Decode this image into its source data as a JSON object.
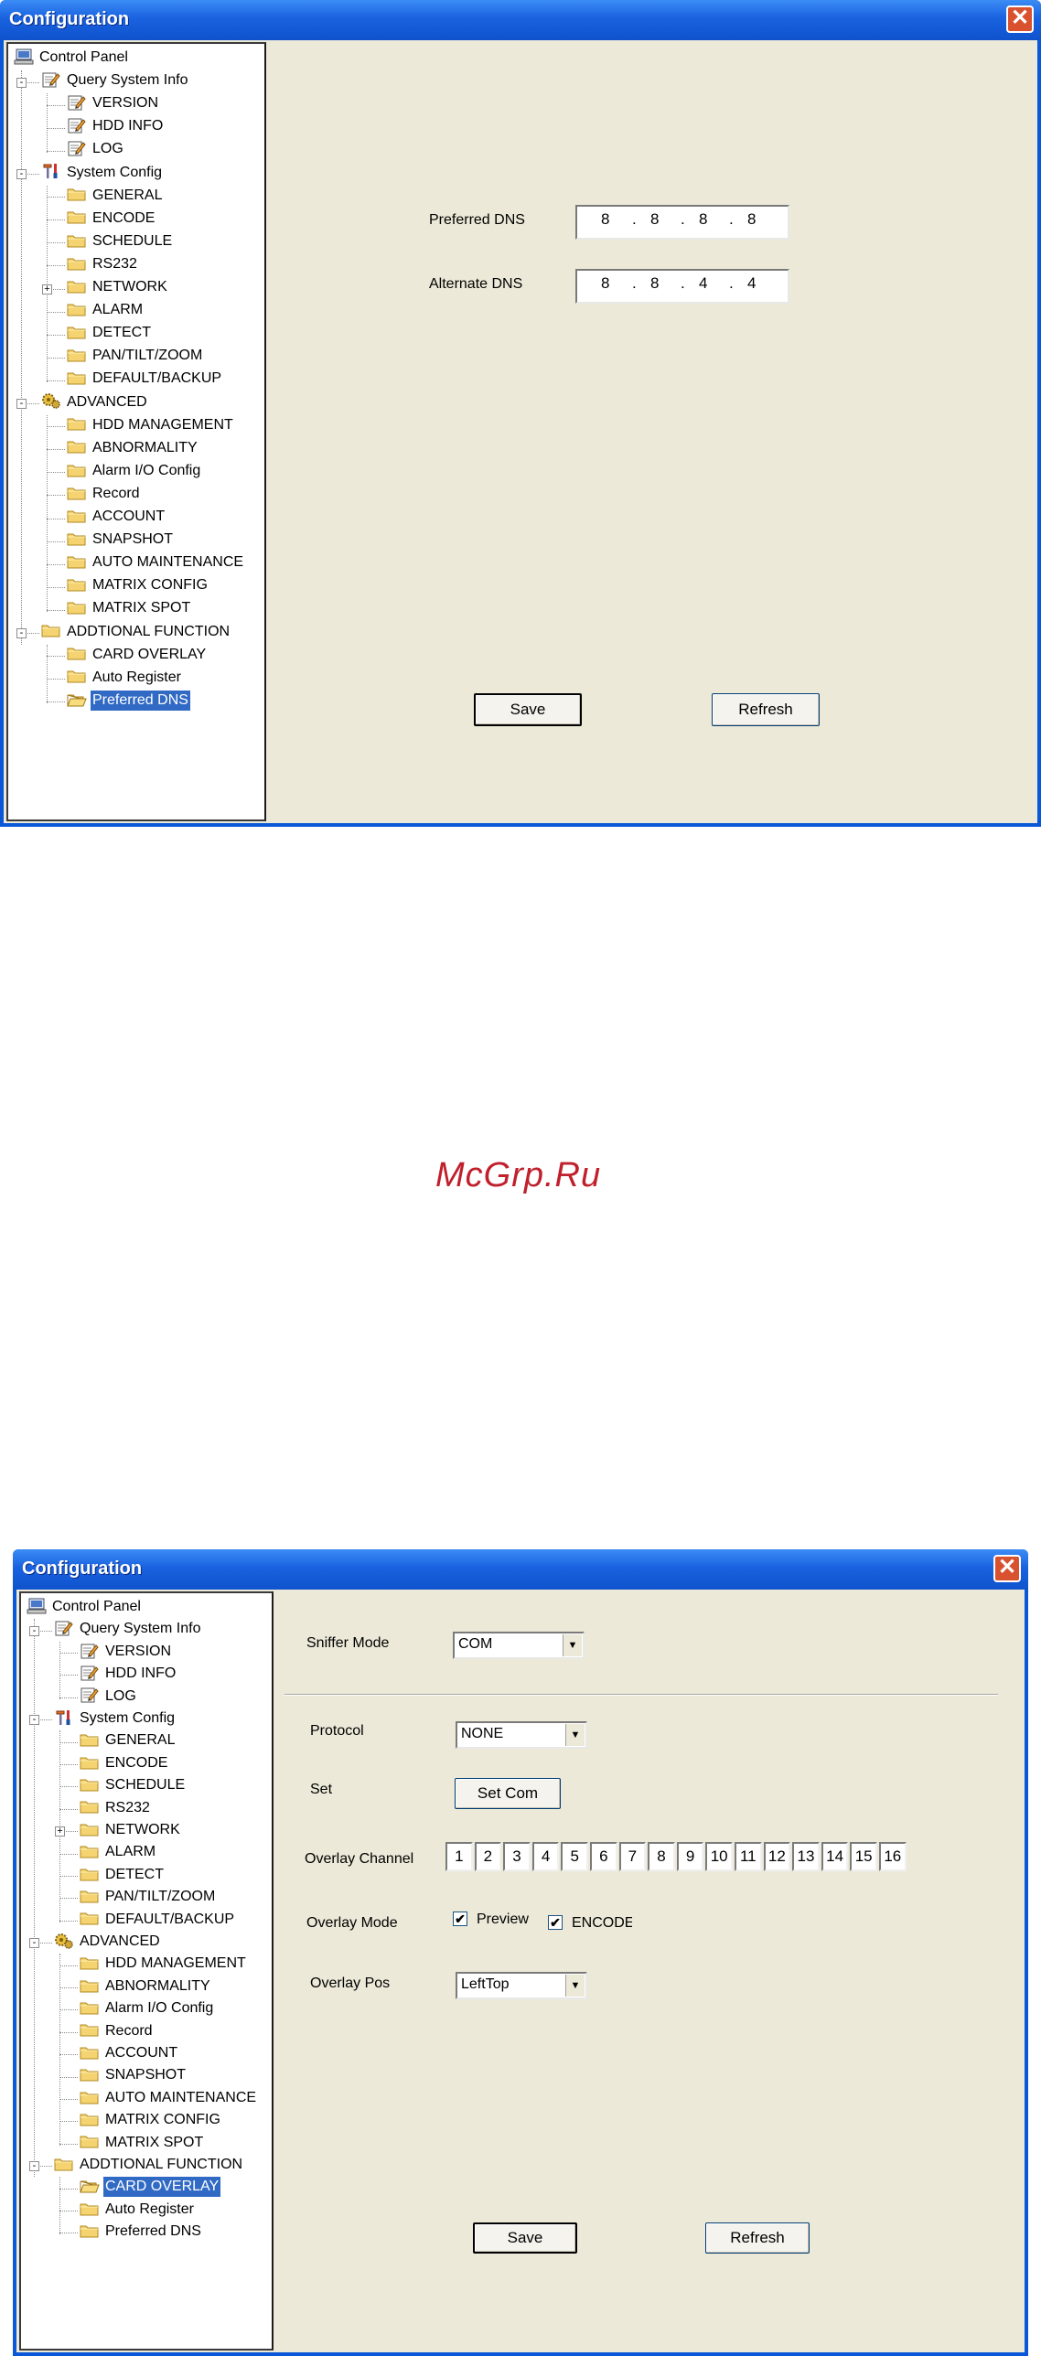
{
  "window1": {
    "title": "Configuration",
    "tree": [
      {
        "label": "Control Panel",
        "icon": "computer-icon",
        "level": 0
      },
      {
        "label": "Query System Info",
        "icon": "notepad-icon",
        "level": 1,
        "expander": "-"
      },
      {
        "label": "VERSION",
        "icon": "notepad-icon",
        "level": 2
      },
      {
        "label": "HDD INFO",
        "icon": "notepad-icon",
        "level": 2
      },
      {
        "label": "LOG",
        "icon": "notepad-icon",
        "level": 2
      },
      {
        "label": "System Config",
        "icon": "tools-icon",
        "level": 1,
        "expander": "-"
      },
      {
        "label": "GENERAL",
        "icon": "folder-icon",
        "level": 2
      },
      {
        "label": "ENCODE",
        "icon": "folder-icon",
        "level": 2
      },
      {
        "label": "SCHEDULE",
        "icon": "folder-icon",
        "level": 2
      },
      {
        "label": "RS232",
        "icon": "folder-icon",
        "level": 2
      },
      {
        "label": "NETWORK",
        "icon": "folder-icon",
        "level": 2,
        "expander": "+"
      },
      {
        "label": "ALARM",
        "icon": "folder-icon",
        "level": 2
      },
      {
        "label": "DETECT",
        "icon": "folder-icon",
        "level": 2
      },
      {
        "label": "PAN/TILT/ZOOM",
        "icon": "folder-icon",
        "level": 2
      },
      {
        "label": "DEFAULT/BACKUP",
        "icon": "folder-icon",
        "level": 2
      },
      {
        "label": "ADVANCED",
        "icon": "gears-icon",
        "level": 1,
        "expander": "-"
      },
      {
        "label": "HDD MANAGEMENT",
        "icon": "folder-icon",
        "level": 2
      },
      {
        "label": "ABNORMALITY",
        "icon": "folder-icon",
        "level": 2
      },
      {
        "label": "Alarm I/O Config",
        "icon": "folder-icon",
        "level": 2
      },
      {
        "label": "Record",
        "icon": "folder-icon",
        "level": 2
      },
      {
        "label": "ACCOUNT",
        "icon": "folder-icon",
        "level": 2
      },
      {
        "label": "SNAPSHOT",
        "icon": "folder-icon",
        "level": 2
      },
      {
        "label": "AUTO MAINTENANCE",
        "icon": "folder-icon",
        "level": 2
      },
      {
        "label": "MATRIX CONFIG",
        "icon": "folder-icon",
        "level": 2
      },
      {
        "label": "MATRIX SPOT",
        "icon": "folder-icon",
        "level": 2
      },
      {
        "label": "ADDTIONAL FUNCTION",
        "icon": "folder-icon",
        "level": 1,
        "expander": "-"
      },
      {
        "label": "CARD OVERLAY",
        "icon": "folder-icon",
        "level": 2
      },
      {
        "label": "Auto Register",
        "icon": "folder-icon",
        "level": 2
      },
      {
        "label": "Preferred DNS",
        "icon": "open-folder-icon",
        "level": 2,
        "selected": true
      }
    ],
    "preferred_dns_label": "Preferred DNS",
    "preferred_dns": [
      "8",
      "8",
      "8",
      "8"
    ],
    "alternate_dns_label": "Alternate DNS",
    "alternate_dns": [
      "8",
      "8",
      "4",
      "4"
    ],
    "ip_dot": ".",
    "save_label": "Save",
    "refresh_label": "Refresh"
  },
  "watermark": "McGrp.Ru",
  "window2": {
    "title": "Configuration",
    "tree": [
      {
        "label": "Control Panel",
        "icon": "computer-icon",
        "level": 0
      },
      {
        "label": "Query System Info",
        "icon": "notepad-icon",
        "level": 1,
        "expander": "-"
      },
      {
        "label": "VERSION",
        "icon": "notepad-icon",
        "level": 2
      },
      {
        "label": "HDD INFO",
        "icon": "notepad-icon",
        "level": 2
      },
      {
        "label": "LOG",
        "icon": "notepad-icon",
        "level": 2
      },
      {
        "label": "System Config",
        "icon": "tools-icon",
        "level": 1,
        "expander": "-"
      },
      {
        "label": "GENERAL",
        "icon": "folder-icon",
        "level": 2
      },
      {
        "label": "ENCODE",
        "icon": "folder-icon",
        "level": 2
      },
      {
        "label": "SCHEDULE",
        "icon": "folder-icon",
        "level": 2
      },
      {
        "label": "RS232",
        "icon": "folder-icon",
        "level": 2
      },
      {
        "label": "NETWORK",
        "icon": "folder-icon",
        "level": 2,
        "expander": "+"
      },
      {
        "label": "ALARM",
        "icon": "folder-icon",
        "level": 2
      },
      {
        "label": "DETECT",
        "icon": "folder-icon",
        "level": 2
      },
      {
        "label": "PAN/TILT/ZOOM",
        "icon": "folder-icon",
        "level": 2
      },
      {
        "label": "DEFAULT/BACKUP",
        "icon": "folder-icon",
        "level": 2
      },
      {
        "label": "ADVANCED",
        "icon": "gears-icon",
        "level": 1,
        "expander": "-"
      },
      {
        "label": "HDD MANAGEMENT",
        "icon": "folder-icon",
        "level": 2
      },
      {
        "label": "ABNORMALITY",
        "icon": "folder-icon",
        "level": 2
      },
      {
        "label": "Alarm I/O Config",
        "icon": "folder-icon",
        "level": 2
      },
      {
        "label": "Record",
        "icon": "folder-icon",
        "level": 2
      },
      {
        "label": "ACCOUNT",
        "icon": "folder-icon",
        "level": 2
      },
      {
        "label": "SNAPSHOT",
        "icon": "folder-icon",
        "level": 2
      },
      {
        "label": "AUTO MAINTENANCE",
        "icon": "folder-icon",
        "level": 2
      },
      {
        "label": "MATRIX CONFIG",
        "icon": "folder-icon",
        "level": 2
      },
      {
        "label": "MATRIX SPOT",
        "icon": "folder-icon",
        "level": 2
      },
      {
        "label": "ADDTIONAL FUNCTION",
        "icon": "folder-icon",
        "level": 1,
        "expander": "-"
      },
      {
        "label": "CARD OVERLAY",
        "icon": "open-folder-icon",
        "level": 2,
        "selected": true
      },
      {
        "label": "Auto Register",
        "icon": "folder-icon",
        "level": 2
      },
      {
        "label": "Preferred DNS",
        "icon": "folder-icon",
        "level": 2
      }
    ],
    "sniffer_mode_label": "Sniffer Mode",
    "sniffer_mode_value": "COM",
    "protocol_label": "Protocol",
    "protocol_value": "NONE",
    "set_label": "Set",
    "set_com_label": "Set Com",
    "overlay_channel_label": "Overlay Channel",
    "channels": [
      "1",
      "2",
      "3",
      "4",
      "5",
      "6",
      "7",
      "8",
      "9",
      "10",
      "11",
      "12",
      "13",
      "14",
      "15",
      "16"
    ],
    "overlay_mode_label": "Overlay Mode",
    "preview_label": "Preview",
    "preview_checked": true,
    "encode_label": "ENCODE",
    "encode_checked": true,
    "overlay_pos_label": "Overlay Pos",
    "overlay_pos_value": "LeftTop",
    "check_mark": "✔",
    "dropdown_arrow": "▼",
    "save_label": "Save",
    "refresh_label": "Refresh"
  },
  "close_glyph": "✕",
  "colors": {
    "titlebar": "#0f52cc",
    "panel": "#ece9d8",
    "selection": "#316ac5",
    "watermark": "#c0202c"
  }
}
